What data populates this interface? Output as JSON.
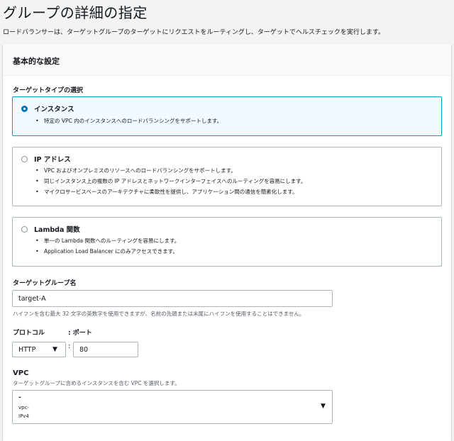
{
  "page": {
    "title": "グループの詳細の指定",
    "description": "ロードバランサーは、ターゲットグループのターゲットにリクエストをルーティングし、ターゲットでヘルスチェックを実行します。"
  },
  "panel": {
    "title": "基本的な設定"
  },
  "target_type": {
    "label": "ターゲットタイプの選択",
    "selected": "instance",
    "options": [
      {
        "title": "インスタンス",
        "bullets": [
          "特定の VPC 内のインスタンスへのロードバランシングをサポートします。"
        ]
      },
      {
        "title": "IP アドレス",
        "bullets": [
          "VPC およびオンプレミスのリソースへのロードバランシングをサポートします。",
          "同じインスタンス上の複数の IP アドレスとネットワークインターフェイスへのルーティングを容易にします。",
          "マイクロサービスベースのアーキテクチャに柔軟性を提供し、アプリケーション間の通信を簡素化します。"
        ]
      },
      {
        "title": "Lambda 関数",
        "bullets": [
          "単一の Lambda 関数へのルーティングを容易にします。",
          "Application Load Balancer にのみアクセスできます。"
        ]
      }
    ]
  },
  "target_group_name": {
    "label": "ターゲットグループ名",
    "value": "target-A",
    "hint": "ハイフンを含む最大 32 文字の英数字を使用できますが、名前の先頭または末尾にハイフンを使用することはできません。"
  },
  "protocol": {
    "label": "プロトコル",
    "port_label": ": ポート",
    "value": "HTTP",
    "separator": ":",
    "port": "80"
  },
  "vpc": {
    "label": "VPC",
    "hint": "ターゲットグループに含めるインスタンスを含む VPC を選択します。",
    "value_line1": "-",
    "value_line2": "vpc-",
    "value_line3": "IPv4"
  }
}
